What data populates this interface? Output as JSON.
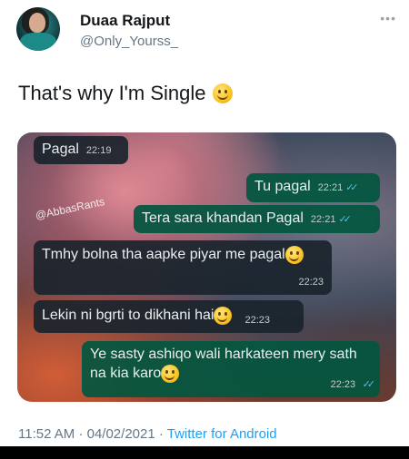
{
  "tweet": {
    "author_name": "Duaa Rajput",
    "author_handle": "@Only_Yourss_",
    "more_icon": "more-dots-icon",
    "text": "That's why I'm Single",
    "text_emoji": "slightly-smiling-face-icon"
  },
  "media": {
    "watermark": "@AbbasRants",
    "messages": [
      {
        "direction": "incoming",
        "text": "Pagal",
        "time": "22:19"
      },
      {
        "direction": "outgoing",
        "text": "Tu pagal",
        "time": "22:21",
        "ticks": "✓✓"
      },
      {
        "direction": "outgoing",
        "text": "Tera sara khandan Pagal",
        "time": "22:21",
        "ticks": "✓✓"
      },
      {
        "direction": "incoming",
        "text": "Tmhy bolna tha aapke piyar me pagal",
        "time": "22:23",
        "emoji": "slightly-smiling-face-icon"
      },
      {
        "direction": "incoming",
        "text": "Lekin ni bgrti to dikhani hai",
        "time": "22:23",
        "emoji": "slightly-smiling-face-icon"
      },
      {
        "direction": "outgoing",
        "text_line1": "Ye sasty ashiqo wali harkateen mery sath",
        "text_line2": "na kia karo",
        "time": "22:23",
        "ticks": "✓✓",
        "emoji": "slightly-smiling-face-icon"
      }
    ],
    "colors": {
      "outgoing_bubble": "#035640",
      "incoming_bubble": "#1a242c",
      "read_ticks": "#53bdeb"
    }
  },
  "footer": {
    "time": "11:52 AM",
    "separator": "·",
    "date": "04/02/2021",
    "source": "Twitter for Android"
  }
}
